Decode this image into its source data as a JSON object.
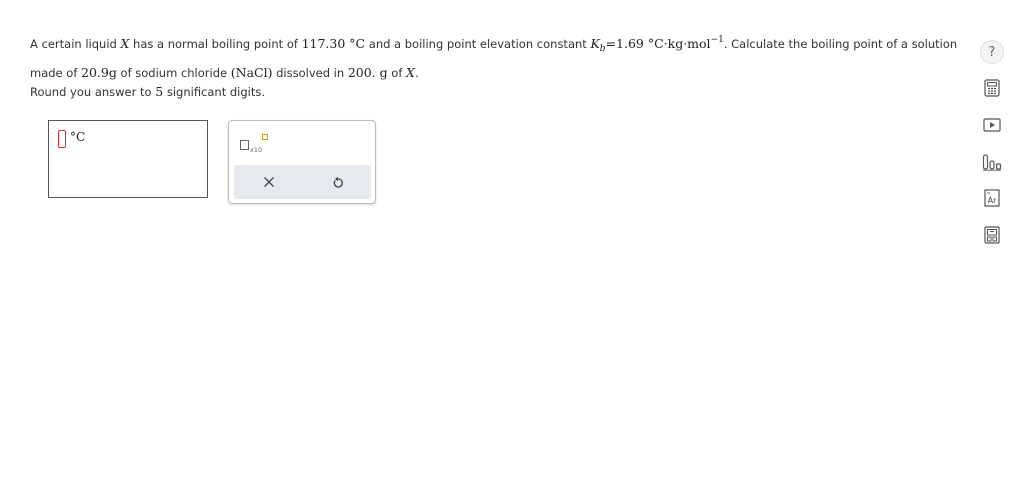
{
  "question": {
    "line1_pre": "A certain liquid",
    "var_x": "X",
    "line1_mid": "has a normal boiling point of",
    "bp_value": "117.30 °C",
    "line1_mid2": "and a boiling point elevation constant",
    "kb_symbol": "K",
    "kb_sub": "b",
    "kb_expr": "=1.69 °C·kg·mol",
    "kb_exp": "−1",
    "line1_post": ". Calculate the boiling point of a solution",
    "line2_pre": "made of",
    "mass_value": "20.9g",
    "line2_mid": "of sodium chloride",
    "formula": "(NaCl)",
    "line2_mid2": "dissolved in",
    "solvent_mass": "200. g",
    "line2_of": "of",
    "line2_end": "."
  },
  "instruction": {
    "pre": "Round you answer to",
    "digits": "5",
    "post": "significant digits."
  },
  "answer": {
    "value": "",
    "unit": "°C"
  },
  "palette": {
    "sci_label": "x10",
    "clear_icon": "close-icon",
    "undo_icon": "undo-icon"
  },
  "sidebar": {
    "help_label": "?",
    "icons": [
      "help-icon",
      "calculator-icon",
      "video-icon",
      "chart-icon",
      "periodic-table-icon",
      "data-icon"
    ],
    "periodic_label": "Ar"
  }
}
